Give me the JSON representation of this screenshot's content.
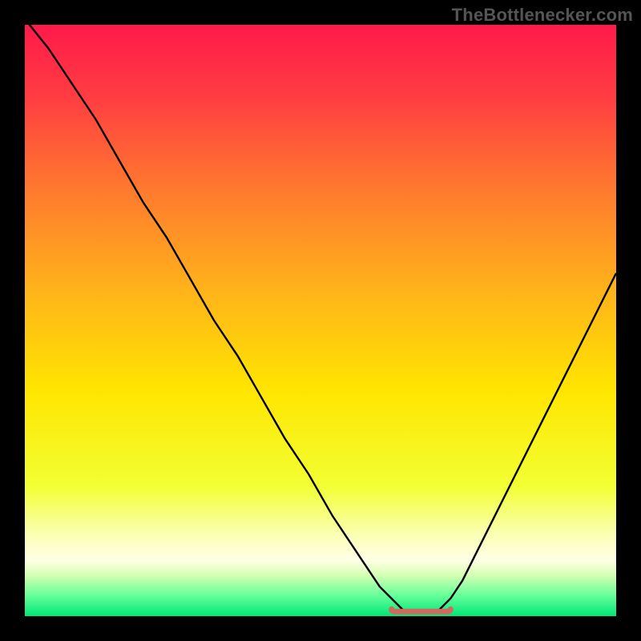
{
  "attribution": "TheBottlenecker.com",
  "chart_data": {
    "type": "line",
    "title": "",
    "xlabel": "",
    "ylabel": "",
    "xlim": [
      0,
      100
    ],
    "ylim": [
      0,
      100
    ],
    "series": [
      {
        "name": "curve",
        "x": [
          0,
          4,
          8,
          12,
          16,
          20,
          24,
          28,
          32,
          36,
          40,
          44,
          48,
          52,
          56,
          60,
          62,
          64,
          66,
          68,
          70,
          72,
          74,
          76,
          78,
          80,
          84,
          88,
          92,
          96,
          100
        ],
        "y": [
          101,
          96,
          90,
          84,
          77,
          70,
          64,
          57,
          50,
          44,
          37,
          30,
          24,
          17,
          11,
          5,
          3,
          1,
          0.5,
          0.5,
          1,
          3,
          6,
          10,
          14,
          18,
          26,
          34,
          42,
          50,
          58
        ]
      }
    ],
    "flat_zone": {
      "x_start": 62,
      "x_end": 72,
      "y": 0.5
    },
    "gradient_stops": [
      {
        "offset": 0.0,
        "color": "#ff1a4a"
      },
      {
        "offset": 0.12,
        "color": "#ff3c42"
      },
      {
        "offset": 0.28,
        "color": "#ff7a2e"
      },
      {
        "offset": 0.45,
        "color": "#ffb31a"
      },
      {
        "offset": 0.62,
        "color": "#ffe600"
      },
      {
        "offset": 0.78,
        "color": "#f2ff33"
      },
      {
        "offset": 0.86,
        "color": "#fbffb0"
      },
      {
        "offset": 0.905,
        "color": "#ffffe6"
      },
      {
        "offset": 0.93,
        "color": "#d6ffb3"
      },
      {
        "offset": 0.965,
        "color": "#66ff99"
      },
      {
        "offset": 1.0,
        "color": "#00e676"
      }
    ],
    "flat_marker_color": "#d06a60",
    "curve_color": "#000000"
  }
}
